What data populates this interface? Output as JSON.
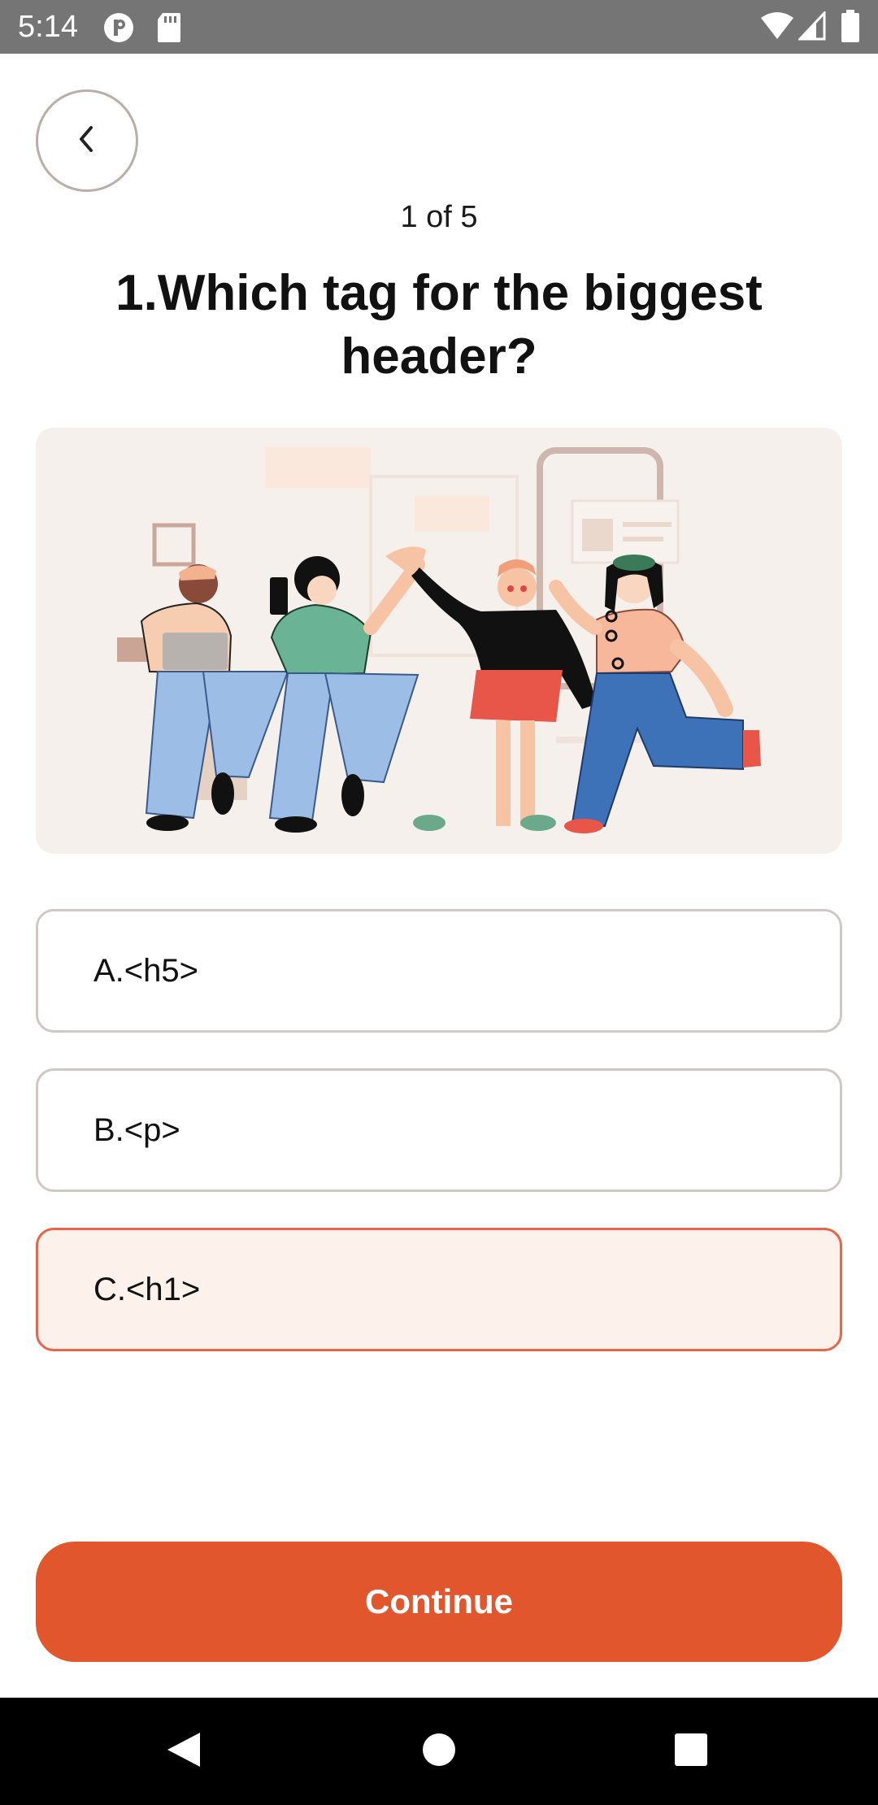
{
  "status_bar": {
    "time": "5:14",
    "icons_left": [
      "privacy-app-icon",
      "sd-card-icon"
    ],
    "icons_right": [
      "wifi-icon",
      "cellular-signal-icon",
      "battery-icon"
    ]
  },
  "header": {
    "back_icon": "chevron-left-icon",
    "progress": "1 of 5",
    "question": "1.Which tag for the biggest header?"
  },
  "illustration": {
    "description_icon": "people-celebrating-illustration"
  },
  "options": [
    {
      "label": "A.<h5>",
      "selected": false
    },
    {
      "label": "B.<p>",
      "selected": false
    },
    {
      "label": "C.<h1>",
      "selected": true
    }
  ],
  "continue_label": "Continue",
  "nav_bar": {
    "icons": [
      "back-triangle-icon",
      "home-circle-icon",
      "recents-square-icon"
    ]
  },
  "colors": {
    "accent": "#e1562c",
    "selected_border": "#e8654a",
    "selected_bg": "#fdf1ec",
    "status_bar": "#757575",
    "card_bg": "#f6f0ec"
  }
}
